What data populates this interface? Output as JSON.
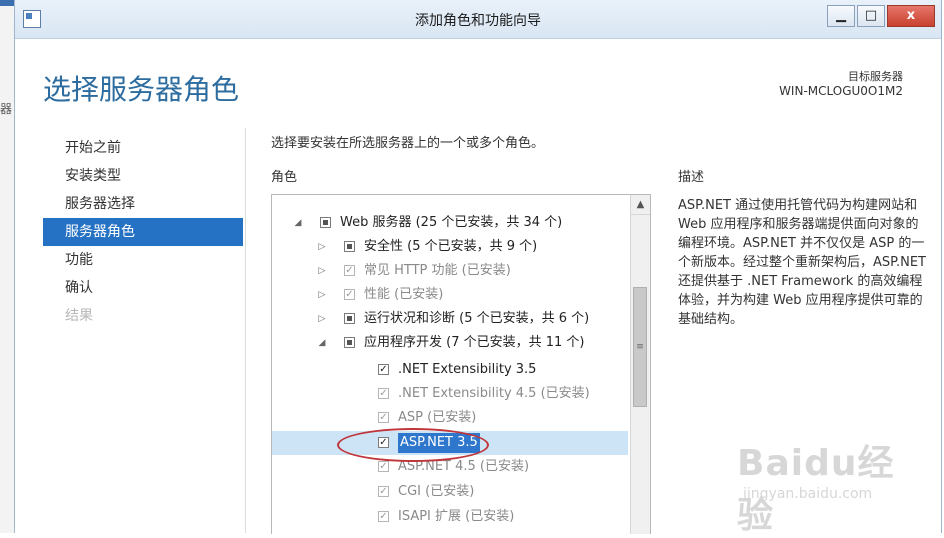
{
  "window": {
    "title": "添加角色和功能向导",
    "min_label": "▁",
    "max_label": "□",
    "close_label": "x"
  },
  "left_fragment": "器",
  "page_title": "选择服务器角色",
  "target_server": {
    "label": "目标服务器",
    "name": "WIN-MCLOGU0O1M2"
  },
  "nav": {
    "items": [
      {
        "label": "开始之前",
        "state": "normal"
      },
      {
        "label": "安装类型",
        "state": "normal"
      },
      {
        "label": "服务器选择",
        "state": "normal"
      },
      {
        "label": "服务器角色",
        "state": "active"
      },
      {
        "label": "功能",
        "state": "normal"
      },
      {
        "label": "确认",
        "state": "normal"
      },
      {
        "label": "结果",
        "state": "disabled"
      }
    ]
  },
  "instruction": "选择要安装在所选服务器上的一个或多个角色。",
  "roles_header": "角色",
  "tree": {
    "rows": [
      {
        "label": "Web 服务器 (25 个已安装，共 34 个)",
        "check": "partial",
        "expander": "◢",
        "faded": false
      },
      {
        "label": "安全性 (5 个已安装，共 9 个)",
        "check": "partial",
        "expander": "▷",
        "faded": false
      },
      {
        "label": "常见 HTTP 功能 (已安装)",
        "check": "checked",
        "expander": "▷",
        "faded": true
      },
      {
        "label": "性能 (已安装)",
        "check": "checked",
        "expander": "▷",
        "faded": true
      },
      {
        "label": "运行状况和诊断 (5 个已安装，共 6 个)",
        "check": "partial",
        "expander": "▷",
        "faded": false
      },
      {
        "label": "应用程序开发 (7 个已安装，共 11 个)",
        "check": "partial",
        "expander": "◢",
        "faded": false
      },
      {
        "label": ".NET Extensibility 3.5",
        "check": "checked",
        "expander": "",
        "faded": false
      },
      {
        "label": ".NET Extensibility 4.5 (已安装)",
        "check": "checked",
        "expander": "",
        "faded": true
      },
      {
        "label": "ASP (已安装)",
        "check": "checked",
        "expander": "",
        "faded": true
      },
      {
        "label": "ASP.NET 3.5",
        "check": "checked",
        "expander": "",
        "faded": false
      },
      {
        "label": "ASP.NET 4.5 (已安装)",
        "check": "checked",
        "expander": "",
        "faded": true
      },
      {
        "label": "CGI (已安装)",
        "check": "checked",
        "expander": "",
        "faded": true
      },
      {
        "label": "ISAPI 扩展 (已安装)",
        "check": "checked",
        "expander": "",
        "faded": true
      }
    ],
    "selected_index": 9
  },
  "description": {
    "header": "描述",
    "text": "ASP.NET 通过使用托管代码为构建网站和 Web 应用程序和服务器端提供面向对象的编程环境。ASP.NET 并不仅仅是 ASP 的一个新版本。经过整个重新架构后，ASP.NET 还提供基于 .NET Framework 的高效编程体验，并为构建 Web 应用程序提供可靠的基础结构。"
  },
  "watermark": {
    "logo": "Baidu经验",
    "url": "jingyan.baidu.com"
  },
  "colors": {
    "accent": "#2572c4",
    "title": "#2d6c9f",
    "annotation": "#c0353a"
  }
}
